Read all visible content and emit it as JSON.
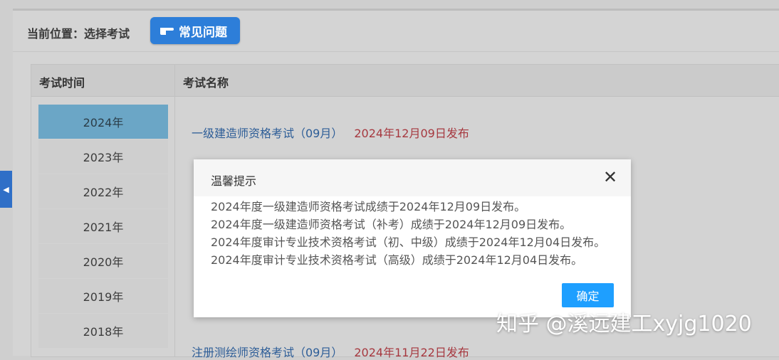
{
  "breadcrumb": "当前位置：选择考试",
  "faq_button": "常见问题",
  "table": {
    "col_time": "考试时间",
    "col_name": "考试名称"
  },
  "years": [
    "2024年",
    "2023年",
    "2022年",
    "2021年",
    "2020年",
    "2019年",
    "2018年"
  ],
  "active_year": "2024年",
  "exams": [
    {
      "name": "一级建造师资格考试（09月）",
      "date": "2024年12月09日发布"
    },
    {
      "name": "注册测绘师资格考试（09月）",
      "date": "2024年11月22日发布"
    }
  ],
  "modal": {
    "title": "温馨提示",
    "lines": [
      "2024年度一级建造师资格考试成绩于2024年12月09日发布。",
      "2024年度一级建造师资格考试（补考）成绩于2024年12月09日发布。",
      "2024年度审计专业技术资格考试（初、中级）成绩于2024年12月04日发布。",
      "2024年度审计专业技术资格考试（高级）成绩于2024年12月04日发布。"
    ],
    "confirm": "确定",
    "close_icon": "close-icon"
  },
  "watermark": "知乎 @溪远建工xyjg1020",
  "colors": {
    "faq_button": "#2d7ed9",
    "active_year": "#6ba6c6",
    "confirm_button": "#1e9fff",
    "exam_link": "#2d5d97",
    "exam_date": "#a6383f"
  }
}
